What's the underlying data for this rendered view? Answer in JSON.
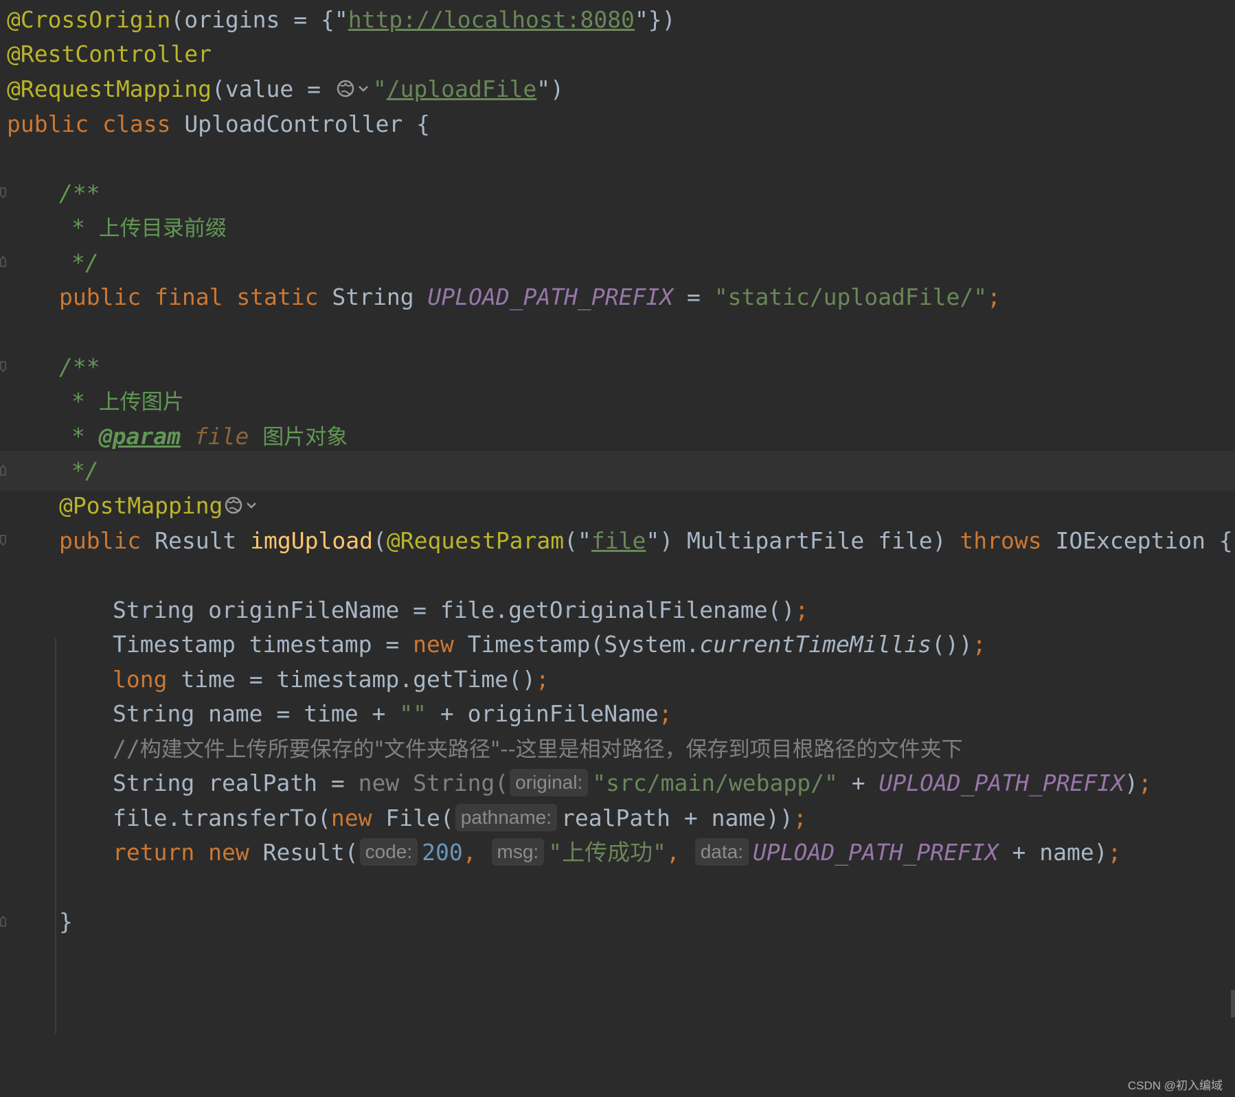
{
  "editor": {
    "theme": "darcula",
    "colors": {
      "background": "#2b2b2b",
      "current_line": "#323232",
      "annotation": "#bbb529",
      "keyword": "#cc7832",
      "string": "#6a8759",
      "doc_comment": "#629755",
      "constant": "#9876aa",
      "method_decl": "#ffc66d",
      "number": "#6897bb",
      "identifier": "#a9b7c6"
    },
    "tokens": {
      "cross_origin": "@CrossOrigin",
      "origins_kw": "(origins = {\"",
      "origins_url": "http://localhost:8080",
      "origins_close": "\"})",
      "rest_controller": "@RestController",
      "request_mapping": "@RequestMapping",
      "rm_value": "(value = ",
      "rm_q1": "\"",
      "rm_path": "/uploadFile",
      "rm_q2": "\")",
      "kw_public": "public",
      "kw_class": "class",
      "class_name": "UploadController {",
      "doc_open": "/**",
      "doc_star": "* ",
      "doc_prefix_text": "上传目录前缀",
      "doc_close": "*/",
      "kw_final": "final",
      "kw_static": "static",
      "type_string": "String",
      "const_name": "UPLOAD_PATH_PREFIX",
      "equals": " = ",
      "prefix_value": "\"static/uploadFile/\"",
      "semicolon": ";",
      "doc_upload_img": "上传图片",
      "doc_param_tag": "@param",
      "doc_param_name": "file",
      "doc_param_desc": "图片对象",
      "post_mapping": "@PostMapping",
      "type_result": "Result",
      "method_name": "imgUpload",
      "paren_open": "(",
      "request_param": "@RequestParam",
      "rp_open": "(\"",
      "rp_value": "file",
      "rp_close": "\")",
      "param_decl": " MultipartFile file) ",
      "kw_throws": "throws",
      "exception": " IOException {",
      "l1_decl": "String originFileName = file.getOriginalFilename()",
      "l2_a": "Timestamp timestamp = ",
      "kw_new": "new",
      "l2_b": " Timestamp(System.",
      "l2_method": "currentTimeMillis",
      "l2_c": "())",
      "kw_long": "long",
      "l3_rest": " time = timestamp.getTime()",
      "l4_a": "String name = time + ",
      "empty_str": "\"\"",
      "l4_b": " + originFileName",
      "comment_slashes": "//",
      "comment_text": "构建文件上传所要保存的\"文件夹路径\"--这里是相对路径，保存到项目根路径的文件夹下",
      "l6_a": "String realPath = ",
      "l6_new_string": "new String(",
      "hint_original": "original:",
      "l6_str": "\"src/main/webapp/\"",
      "plus": " + ",
      "paren_close": ")",
      "l7_a": "file.transferTo(",
      "l7_b": " File(",
      "hint_pathname": "pathname:",
      "l7_c": "realPath + name))",
      "kw_return": "return",
      "l8_a": " Result(",
      "hint_code": "code:",
      "num_200": "200",
      "comma": ", ",
      "hint_msg": "msg:",
      "msg_value": "\"上传成功\"",
      "hint_data": "data:",
      "l8_tail": " + name)",
      "close_brace": "}"
    },
    "icons": [
      "globe-icon",
      "chevron-down-icon",
      "fold-marker-icon"
    ]
  },
  "watermark": "CSDN @初入编域"
}
